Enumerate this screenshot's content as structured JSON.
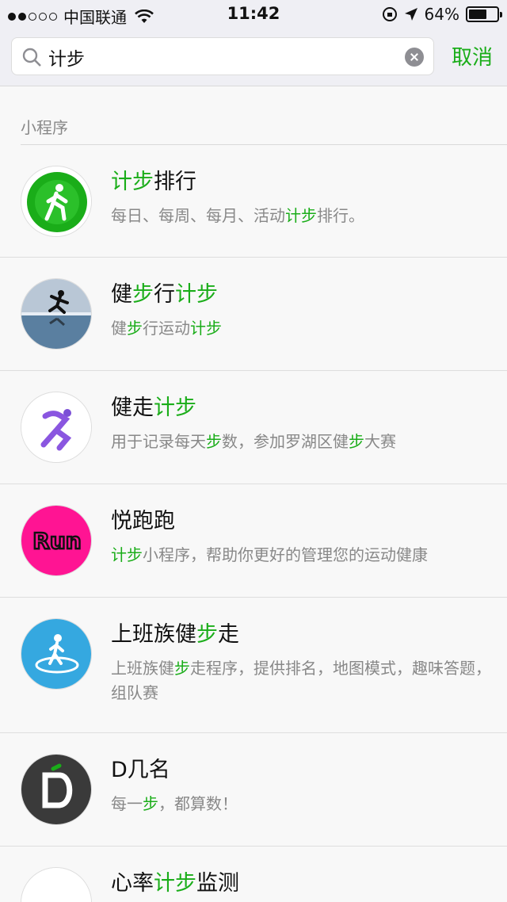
{
  "status_bar": {
    "carrier": "中国联通",
    "time": "11:42",
    "battery": "64%",
    "battery_level": 0.64
  },
  "search": {
    "query": "计步",
    "cancel_label": "取消"
  },
  "section_title": "小程序",
  "results": [
    {
      "icon": "walking-person-icon",
      "title": [
        [
          "计步",
          true
        ],
        [
          "排行",
          false
        ]
      ],
      "desc": [
        [
          "每日、每周、每月、活动",
          false
        ],
        [
          "计步",
          true
        ],
        [
          "排行。",
          false
        ]
      ]
    },
    {
      "icon": "runner-silhouette-icon",
      "title": [
        [
          "健",
          false
        ],
        [
          "步",
          true
        ],
        [
          "行",
          false
        ],
        [
          "计步",
          true
        ]
      ],
      "desc": [
        [
          "健",
          false
        ],
        [
          "步",
          true
        ],
        [
          "行运动",
          false
        ],
        [
          "计步",
          true
        ]
      ]
    },
    {
      "icon": "purple-runner-icon",
      "title": [
        [
          "健走",
          false
        ],
        [
          "计步",
          true
        ]
      ],
      "desc": [
        [
          "用于记录每天",
          false
        ],
        [
          "步",
          true
        ],
        [
          "数，参加罗湖区健",
          false
        ],
        [
          "步",
          true
        ],
        [
          "大赛",
          false
        ]
      ]
    },
    {
      "icon": "run-logo-icon",
      "title": [
        [
          "悦跑跑",
          false
        ]
      ],
      "desc": [
        [
          "计步",
          true
        ],
        [
          "小程序，帮助你更好的管理您的运动健康",
          false
        ]
      ]
    },
    {
      "icon": "walker-circle-icon",
      "title": [
        [
          "上班族健",
          false
        ],
        [
          "步",
          true
        ],
        [
          "走",
          false
        ]
      ],
      "desc": [
        [
          "上班族健",
          false
        ],
        [
          "步",
          true
        ],
        [
          "走程序，提供排名，地图模式，趣味答题，组队赛",
          false
        ]
      ]
    },
    {
      "icon": "d-logo-icon",
      "title": [
        [
          "D几名",
          false
        ]
      ],
      "desc": [
        [
          "每一",
          false
        ],
        [
          "步",
          true
        ],
        [
          "，都算数！",
          false
        ]
      ]
    },
    {
      "icon": "heart-rate-icon",
      "title": [
        [
          "心率",
          false
        ],
        [
          "计步",
          true
        ],
        [
          "监测",
          false
        ]
      ],
      "desc": []
    }
  ]
}
